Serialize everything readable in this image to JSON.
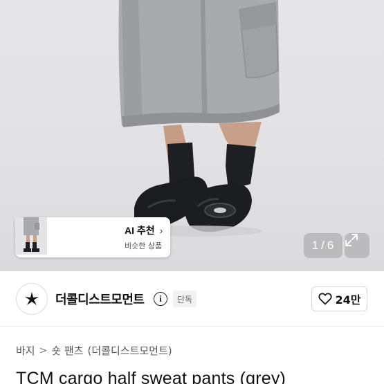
{
  "gallery": {
    "ai_card": {
      "title": "AI 추천",
      "chevron": "›",
      "subtitle": "비슷한 상품"
    },
    "pager": {
      "current": "1",
      "total": "6",
      "separator": "/"
    },
    "expand_icon": "expand-icon"
  },
  "seller": {
    "name": "더콜디스트모먼트",
    "badge": "단독",
    "likes": "24만",
    "logo_icon": "star-logo-icon"
  },
  "breadcrumb": {
    "items": [
      "바지",
      "숏 팬츠",
      "(더콜디스트모먼트)"
    ],
    "separator": ">"
  },
  "product": {
    "title": "TCM cargo half sweat pants (grey)"
  },
  "colors": {
    "text": "#111111",
    "muted": "#555555",
    "badge_bg": "#f1f1f3",
    "pants": "#a7a9ad",
    "shoes": "#1b1c1f"
  }
}
